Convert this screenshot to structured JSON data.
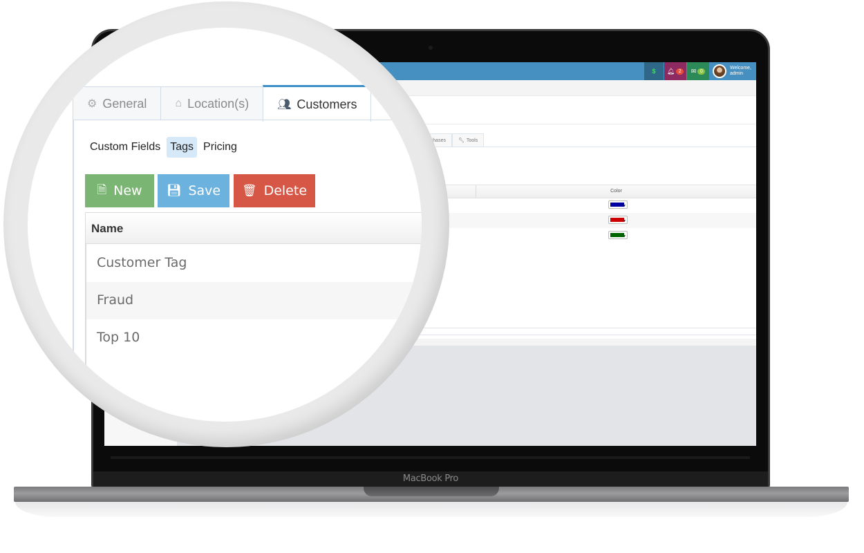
{
  "device": {
    "label": "MacBook Pro"
  },
  "topbar": {
    "dollar_icon": "$",
    "notifications_count": "2",
    "messages_count": "0",
    "welcome_line1": "Welcome,",
    "welcome_line2": "admin",
    "colors": {
      "bar": "#4590c0",
      "dollar": "#2f6789",
      "bell": "#8c2a61",
      "mail": "#2b8a58"
    }
  },
  "main_tabs": [
    {
      "label": "General",
      "icon": "gear-icon",
      "active": false
    },
    {
      "label": "Location(s)",
      "icon": "home-icon",
      "active": false
    },
    {
      "label": "Customers",
      "icon": "users-icon",
      "active": true
    }
  ],
  "secondary_tabs": [
    {
      "label": "Purchases",
      "icon": "cart-icon"
    },
    {
      "label": "Tools",
      "icon": "wrench-icon"
    }
  ],
  "sub_tabs": [
    {
      "label": "Custom Fields",
      "active": false
    },
    {
      "label": "Tags",
      "active": true
    },
    {
      "label": "Pricing",
      "active": false
    }
  ],
  "toolbar": {
    "new_label": "New",
    "save_label": "Save",
    "delete_label": "Delete"
  },
  "table": {
    "columns": [
      "Name",
      "Color"
    ],
    "rows": [
      {
        "name": "Customer Tag",
        "color": "#0000a0"
      },
      {
        "name": "Fraud",
        "color": "#cc0000"
      },
      {
        "name": "Top 10",
        "color": "#006400"
      }
    ]
  }
}
